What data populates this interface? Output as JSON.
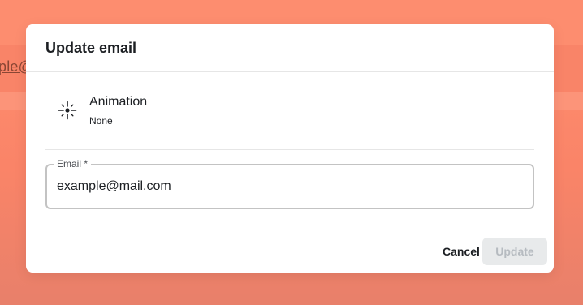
{
  "background": {
    "partial_text": "ple@"
  },
  "dialog": {
    "title": "Update email",
    "animation": {
      "icon": "sparkle-icon",
      "label": "Animation",
      "value": "None"
    },
    "email_field": {
      "label": "Email *",
      "value": "example@mail.com"
    },
    "buttons": {
      "cancel_label": "Cancel",
      "update_label": "Update"
    }
  },
  "colors": {
    "overlay": "#fa8468",
    "dialog_bg": "#ffffff",
    "text_primary": "#1c1f23",
    "field_border": "#c3c3c3",
    "update_disabled_bg": "#e8eaeb",
    "update_disabled_text": "#b6bbc0"
  }
}
